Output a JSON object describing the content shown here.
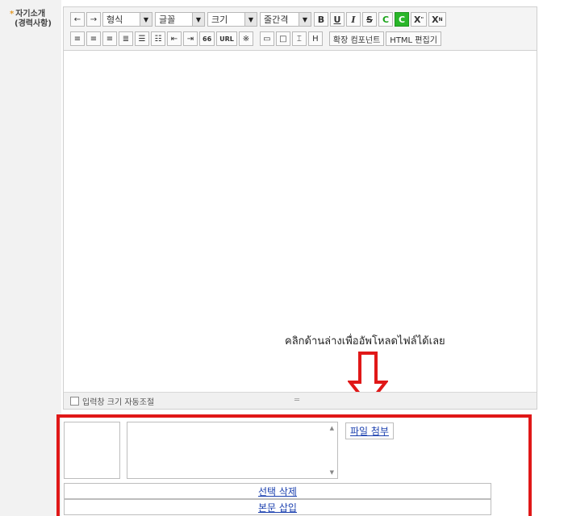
{
  "field": {
    "required_mark": "*",
    "label_line1": "자기소개",
    "label_line2": "(경력사항)"
  },
  "toolbar": {
    "undo": "←",
    "redo": "→",
    "format_select": "형식",
    "font_select": "글꼴",
    "size_select": "크기",
    "line_height_select": "줄간격",
    "bold": "B",
    "underline": "U",
    "italic": "I",
    "strike": "S",
    "font_color": "C",
    "bg_color": "C",
    "superscript_main": "X",
    "superscript_mark": "\"",
    "subscript_main": "X",
    "subscript_mark": "N",
    "align_left": "≡",
    "align_center": "≡",
    "align_right": "≡",
    "align_justify": "≣",
    "ordered_list": "☰",
    "unordered_list": "☷",
    "outdent": "⇤",
    "indent": "⇥",
    "quote": "66",
    "url": "URL",
    "special_char": "※",
    "table1": "▭",
    "table2": "□",
    "table3": "⌶",
    "table4": "H",
    "extend_component": "확장 컴포넌트",
    "html_editor": "HTML 편집기",
    "arrow_down": "▼"
  },
  "editor": {
    "annotation": "คลิกด้านล่างเพื่ออัพโหลดไฟล์ได้เลย",
    "autosize_label": "입력창 크기 자동조절",
    "resize_grip": "═"
  },
  "upload": {
    "attach_button": "파일 첨부",
    "delete_selected": "선택 삭제",
    "insert_body": "본문 삽입",
    "scroll_up": "▲",
    "scroll_down": "▼"
  },
  "colors": {
    "highlight_box": "#e01818",
    "link_blue": "#1a3fae",
    "green": "#29b629"
  }
}
